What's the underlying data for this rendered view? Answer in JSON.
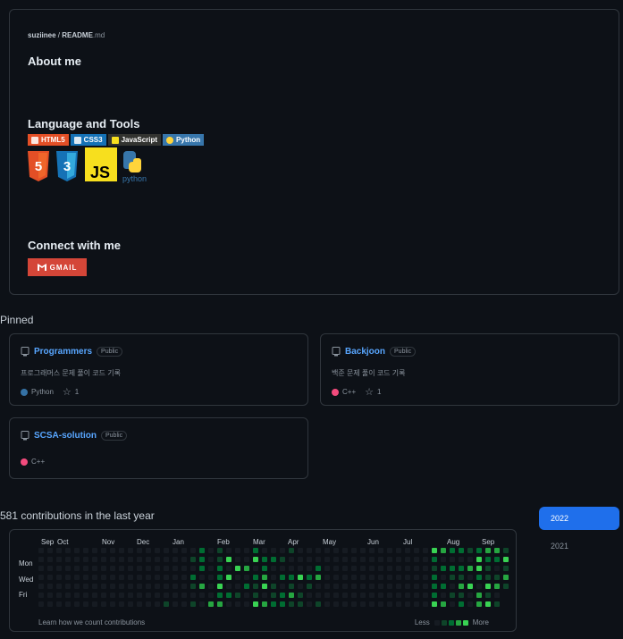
{
  "readme": {
    "owner": "suziinee",
    "file_name": "README",
    "file_ext": ".md",
    "about_heading": "About me",
    "lang_heading": "Language and Tools",
    "connect_heading": "Connect with me",
    "badges": [
      {
        "label": "HTML5",
        "color": "#e34f26",
        "icon": "html5-icon"
      },
      {
        "label": "CSS3",
        "color": "#1572b6",
        "icon": "css3-icon"
      },
      {
        "label": "JavaScript",
        "color": "#323330",
        "icon": "js-icon"
      },
      {
        "label": "Python",
        "color": "#3776ab",
        "icon": "python-icon"
      }
    ],
    "logos": {
      "html": "5",
      "css": "3",
      "js": "JS",
      "python_text": "python"
    },
    "gmail_label": "GMAIL"
  },
  "pinned": {
    "title": "Pinned",
    "repos": [
      {
        "name": "Programmers",
        "visibility": "Public",
        "description": "프로그래머스 문제 풀이 코드 기록",
        "language": "Python",
        "lang_color": "#3572A5",
        "stars": "1"
      },
      {
        "name": "Backjoon",
        "visibility": "Public",
        "description": "백준 문제 풀이 코드 기록",
        "language": "C++",
        "lang_color": "#f34b7d",
        "stars": "1"
      },
      {
        "name": "SCSA-solution",
        "visibility": "Public",
        "description": "",
        "language": "C++",
        "lang_color": "#f34b7d",
        "stars": ""
      }
    ]
  },
  "contributions": {
    "title": "581 contributions in the last year",
    "months": [
      "Sep",
      "Oct",
      "Nov",
      "Dec",
      "Jan",
      "Feb",
      "Mar",
      "Apr",
      "May",
      "Jun",
      "Jul",
      "Aug",
      "Sep"
    ],
    "days": [
      "Mon",
      "Wed",
      "Fri"
    ],
    "learn_link": "Learn how we count contributions",
    "legend_less": "Less",
    "legend_more": "More",
    "colors": [
      "#161b22",
      "#0e4429",
      "#006d32",
      "#26a641",
      "#39d353"
    ]
  },
  "years": {
    "selected": "2022",
    "other": "2021"
  }
}
